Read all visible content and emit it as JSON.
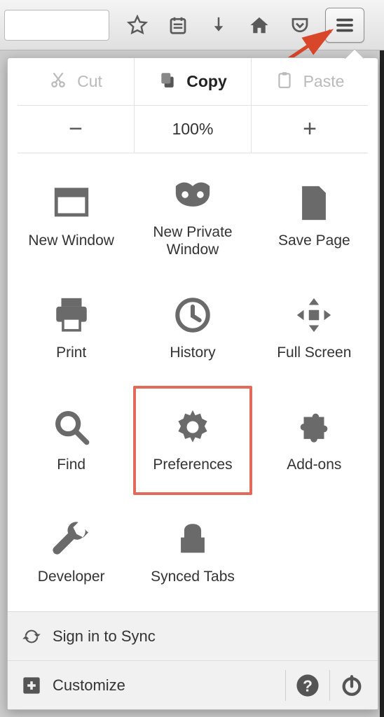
{
  "toolbar": {
    "url_value": "",
    "icons": [
      "star",
      "clipboard",
      "download",
      "home",
      "pocket",
      "menu"
    ]
  },
  "edit_row": {
    "cut": {
      "label": "Cut",
      "enabled": false
    },
    "copy": {
      "label": "Copy",
      "enabled": true
    },
    "paste": {
      "label": "Paste",
      "enabled": false
    }
  },
  "zoom": {
    "minus": "−",
    "level": "100%",
    "plus": "+"
  },
  "grid": [
    {
      "id": "new-window",
      "label": "New Window",
      "icon": "window"
    },
    {
      "id": "new-private",
      "label": "New Private Window",
      "icon": "mask"
    },
    {
      "id": "save-page",
      "label": "Save Page",
      "icon": "page"
    },
    {
      "id": "print",
      "label": "Print",
      "icon": "printer"
    },
    {
      "id": "history",
      "label": "History",
      "icon": "clock"
    },
    {
      "id": "fullscreen",
      "label": "Full Screen",
      "icon": "fullscreen"
    },
    {
      "id": "find",
      "label": "Find",
      "icon": "search"
    },
    {
      "id": "preferences",
      "label": "Preferences",
      "icon": "gear",
      "highlighted": true
    },
    {
      "id": "addons",
      "label": "Add-ons",
      "icon": "puzzle"
    },
    {
      "id": "developer",
      "label": "Developer",
      "icon": "wrench"
    },
    {
      "id": "synced-tabs",
      "label": "Synced Tabs",
      "icon": "tophat"
    }
  ],
  "footer": {
    "sync_label": "Sign in to Sync",
    "customize_label": "Customize",
    "help_icon": "help",
    "power_icon": "power"
  },
  "colors": {
    "highlight_border": "#e26a5a",
    "icon_grey": "#6a6a6a"
  }
}
